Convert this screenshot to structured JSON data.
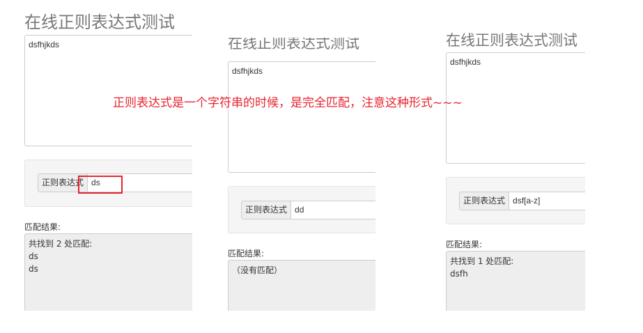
{
  "panels": [
    {
      "title": "在线正则表达式测试",
      "source_text": "dsfhjkds",
      "regex_label": "正则表达式",
      "regex_value": "ds",
      "result_label": "匹配结果:",
      "result_lines": [
        "共找到 2 处匹配:",
        "ds",
        "ds"
      ]
    },
    {
      "title": "在线正则表达式测试",
      "source_text": "dsfhjkds",
      "regex_label": "正则表达式",
      "regex_value": "dd",
      "result_label": "匹配结果:",
      "result_lines": [
        "（没有匹配）"
      ]
    },
    {
      "title": "在线正则表达式测试",
      "source_text": "dsfhjkds",
      "regex_label": "正则表达式",
      "regex_value": "dsf[a-z]",
      "result_label": "匹配结果:",
      "result_lines": [
        "共找到 1 处匹配:",
        "dsfh"
      ]
    }
  ],
  "annotation": "正则表达式是一个字符串的时候，是完全匹配，注意这种形式~~~",
  "colors": {
    "annotation": "#e8232f",
    "title": "#777777",
    "well": "#f5f5f5",
    "result_bg": "#eeeeee"
  }
}
